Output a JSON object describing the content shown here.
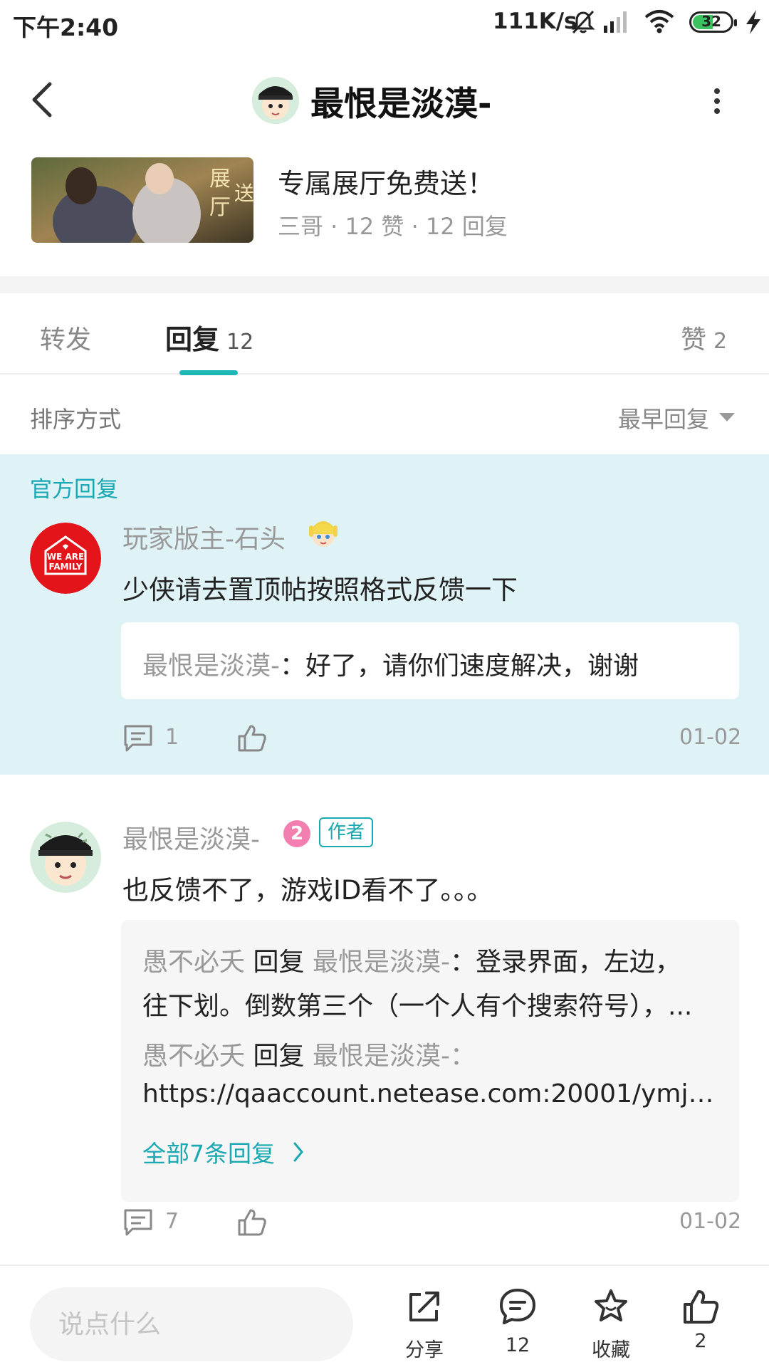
{
  "status_bar": {
    "time": "下午2:40",
    "net_speed": "111K/s",
    "battery": "32"
  },
  "header": {
    "title": "最恨是淡漠-"
  },
  "post": {
    "title": "专属展厅免费送！",
    "meta": "三哥 · 12 赞 · 12 回复"
  },
  "tabs": {
    "forward": "转发",
    "reply": "回复",
    "reply_count": "12",
    "like": "赞",
    "like_count": "2"
  },
  "sort": {
    "label": "排序方式",
    "value": "最早回复"
  },
  "official_reply": {
    "label": "官方回复",
    "user": "玩家版主-石头",
    "avatar_text": "WE ARE FAMILY",
    "text": "少侠请去置顶帖按照格式反馈一下",
    "quote_user": "最恨是淡漠-",
    "quote_text": "：好了，请你们速度解决，谢谢",
    "comment_count": "1",
    "date": "01-02"
  },
  "reply2": {
    "user": "最恨是淡漠-",
    "level": "2",
    "author_badge": "作者",
    "text": "也反馈不了，游戏ID看不了。。。",
    "sub_replies": [
      {
        "from": "愚不必夭",
        "verb": "回复",
        "to": "最恨是淡漠-",
        "line1": "：登录界面，左边，",
        "line2": "往下划。倒数第三个（一个人有个搜索符号），..."
      },
      {
        "from": "愚不必夭",
        "verb": "回复",
        "to": "最恨是淡漠-",
        "line1": "：",
        "line2": "https://qaaccount.netease.com:20001/ymjh/..."
      }
    ],
    "see_all": "全部7条回复",
    "comment_count": "7",
    "date": "01-02"
  },
  "bottom_bar": {
    "input_placeholder": "说点什么",
    "share": "分享",
    "comments": "12",
    "favorite": "收藏",
    "likes": "2"
  },
  "colors": {
    "accent": "#1fb6b8",
    "official_bg": "#dff3f7",
    "official_avatar": "#e4141b"
  },
  "icons": [
    "back-arrow-icon",
    "more-vertical-icon",
    "comment-icon",
    "thumbs-up-icon",
    "share-icon",
    "star-icon",
    "chevron-right-icon",
    "wifi-icon",
    "signal-icon",
    "mute-icon",
    "charging-icon"
  ]
}
